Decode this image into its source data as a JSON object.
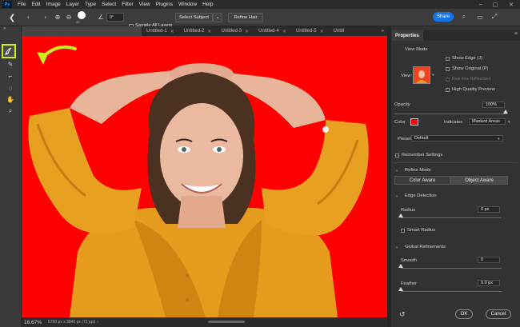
{
  "app": {
    "logo": "Ps"
  },
  "menu": [
    "File",
    "Edit",
    "Image",
    "Layer",
    "Type",
    "Select",
    "Filter",
    "View",
    "Plugins",
    "Window",
    "Help"
  ],
  "options": {
    "brush_size": "40",
    "angle_value": "0°",
    "sample_all_layers": "Sample All Layers",
    "select_subject": "Select Subject",
    "refine_hair": "Refine Hair",
    "share": "Share"
  },
  "tabs": [
    "Untitled-1",
    "Untitled-2",
    "Untitled-3",
    "Untitled-4",
    "Untitled-5",
    "Untitl"
  ],
  "status": {
    "zoom": "16.67%",
    "doc_info": "5760 px x 3840 px (72 ppi)"
  },
  "panel": {
    "title": "Properties",
    "view_mode": "View Mode",
    "view_label": "View:",
    "show_edge": "Show Edge (J)",
    "show_original": "Show Original (P)",
    "realtime_refinement": "Real-time Refinement",
    "high_quality_preview": "High Quality Preview",
    "opacity_label": "Opacity",
    "opacity_value": "100%",
    "color_label": "Color",
    "color_swatch": "#ff0000",
    "indicates_label": "Indicates",
    "indicates_value": "Masked Areas",
    "preset_label": "Preset",
    "preset_value": "Default",
    "remember_settings": "Remember Settings",
    "refine_mode": "Refine Mode",
    "color_aware": "Color Aware",
    "object_aware": "Object Aware",
    "edge_detection": "Edge Detection",
    "radius_label": "Radius",
    "radius_value": "0 px",
    "smart_radius": "Smart Radius",
    "global_refinements": "Global Refinements",
    "smooth_label": "Smooth",
    "smooth_value": "0",
    "feather_label": "Feather",
    "feather_value": "0.0 px",
    "ok": "OK",
    "cancel": "Cancel"
  },
  "colors": {
    "accent": "#1473e6",
    "highlight": "#c8f01e",
    "canvas_bg": "#ff0000",
    "shirt": "#e8a020"
  },
  "icons": [
    "back-chevron-icon",
    "brush-preview-icon",
    "search-icon",
    "workspace-icon",
    "expand-icon",
    "quick-selection-tool-icon",
    "refine-edge-brush-icon",
    "brush-tool-icon",
    "lasso-tool-icon",
    "hand-tool-icon",
    "zoom-tool-icon",
    "reset-icon"
  ]
}
